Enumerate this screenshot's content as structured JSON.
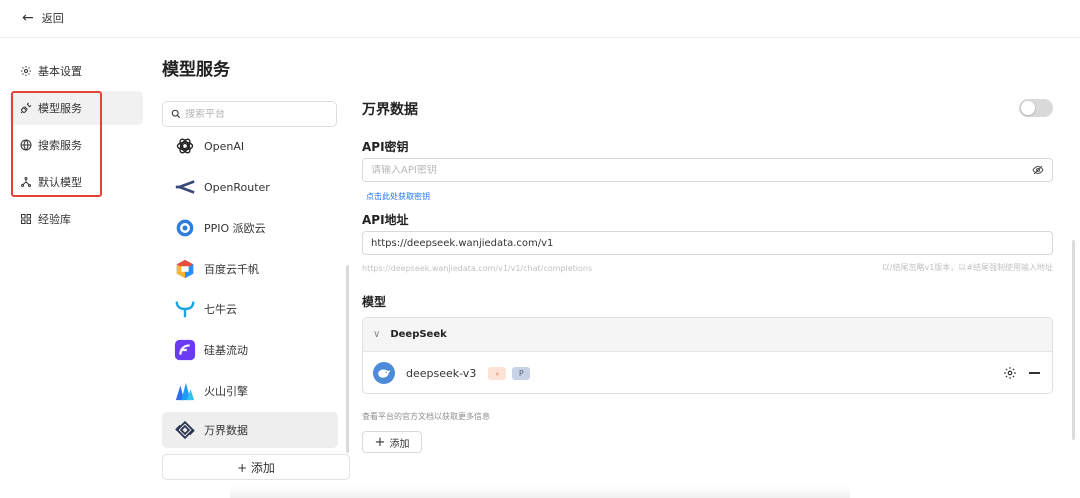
{
  "topbar": {
    "back_label": "返回"
  },
  "sidebar": {
    "items": [
      {
        "label": "基本设置",
        "icon": "gear-icon"
      },
      {
        "label": "模型服务",
        "icon": "plug-icon",
        "active": true
      },
      {
        "label": "搜索服务",
        "icon": "globe-icon"
      },
      {
        "label": "默认模型",
        "icon": "network-icon"
      },
      {
        "label": "经验库",
        "icon": "grid-icon"
      }
    ]
  },
  "page": {
    "title": "模型服务"
  },
  "providers": {
    "search_placeholder": "搜索平台",
    "items": [
      {
        "name": "OpenAI",
        "icon": "openai-logo-icon"
      },
      {
        "name": "OpenRouter",
        "icon": "openrouter-logo-icon"
      },
      {
        "name": "PPIO 派欧云",
        "icon": "ppio-logo-icon"
      },
      {
        "name": "百度云千帆",
        "icon": "baidu-qianfan-logo-icon"
      },
      {
        "name": "七牛云",
        "icon": "qiniu-logo-icon"
      },
      {
        "name": "硅基流动",
        "icon": "siliconflow-logo-icon"
      },
      {
        "name": "火山引擎",
        "icon": "volcengine-logo-icon"
      },
      {
        "name": "万界数据",
        "icon": "wanjie-logo-icon",
        "active": true
      }
    ],
    "add_label": "+ 添加"
  },
  "detail": {
    "title": "万界数据",
    "enabled": false,
    "api_key": {
      "label": "API密钥",
      "placeholder": "请输入API密钥",
      "link": "点击此处获取密钥"
    },
    "api_url": {
      "label": "API地址",
      "value": "https://deepseek.wanjiedata.com/v1",
      "hint_left": "https://deepseek.wanjiedata.com/v1/v1/chat/completions",
      "hint_right": "以/结尾忽略v1版本，以#结尾强制使用输入地址"
    },
    "models": {
      "label": "模型",
      "group_name": "DeepSeek",
      "items": [
        {
          "name": "deepseek-v3",
          "tag1": "⸗",
          "tag2": "P"
        }
      ]
    },
    "doc_hint": "查看平台的官方文档以获取更多信息",
    "add_label": "添加"
  },
  "colors": {
    "highlight_box": "#e3413a",
    "link": "#1677ff",
    "toggle_off": "#d9d9d9"
  }
}
